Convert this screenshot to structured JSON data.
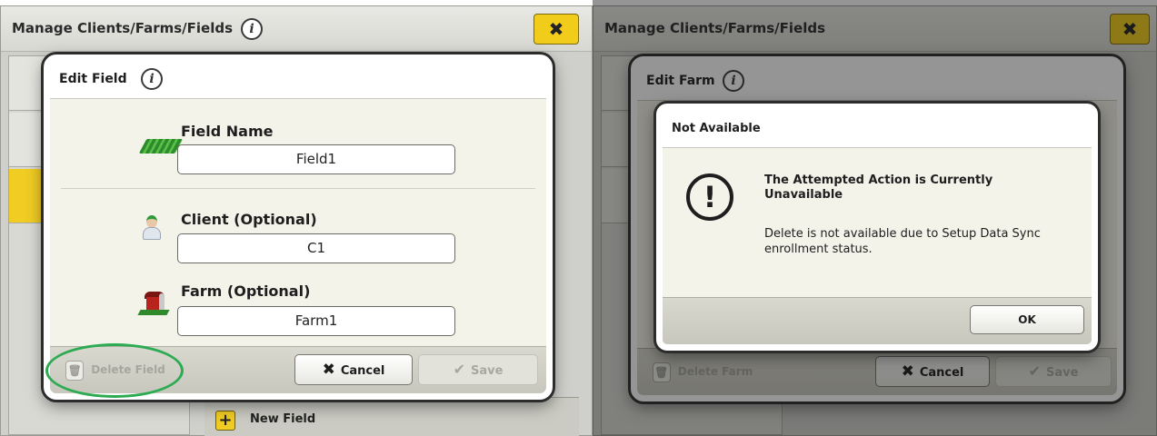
{
  "left_panel": {
    "app_title": "Manage Clients/Farms/Fields",
    "info_icon": "i",
    "close_icon": "✖",
    "new_field_label": "New Field",
    "edit_field": {
      "title": "Edit Field",
      "field_name_label": "Field Name",
      "field_name_value": "Field1",
      "client_label": "Client (Optional)",
      "client_value": "C1",
      "farm_label": "Farm (Optional)",
      "farm_value": "Farm1",
      "delete_label": "Delete Field",
      "cancel_label": "Cancel",
      "save_label": "Save"
    }
  },
  "right_panel": {
    "app_title": "Manage Clients/Farms/Fields",
    "edit_farm": {
      "title": "Edit Farm",
      "delete_label": "Delete Farm",
      "cancel_label": "Cancel",
      "save_label": "Save"
    },
    "alert": {
      "title": "Not Available",
      "heading": "The Attempted Action is Currently Unavailable",
      "message": "Delete is not available due to Setup Data Sync enrollment status.",
      "ok_label": "OK"
    }
  },
  "colors": {
    "accent_yellow": "#f1cc23",
    "highlight_ring": "#2dab52",
    "dialog_background": "#f4f3ea"
  },
  "icons": [
    "info-icon",
    "close-icon",
    "field-icon",
    "client-icon",
    "farm-icon",
    "trash-icon",
    "x-icon",
    "check-icon",
    "alert-exclamation-icon",
    "plus-icon"
  ]
}
